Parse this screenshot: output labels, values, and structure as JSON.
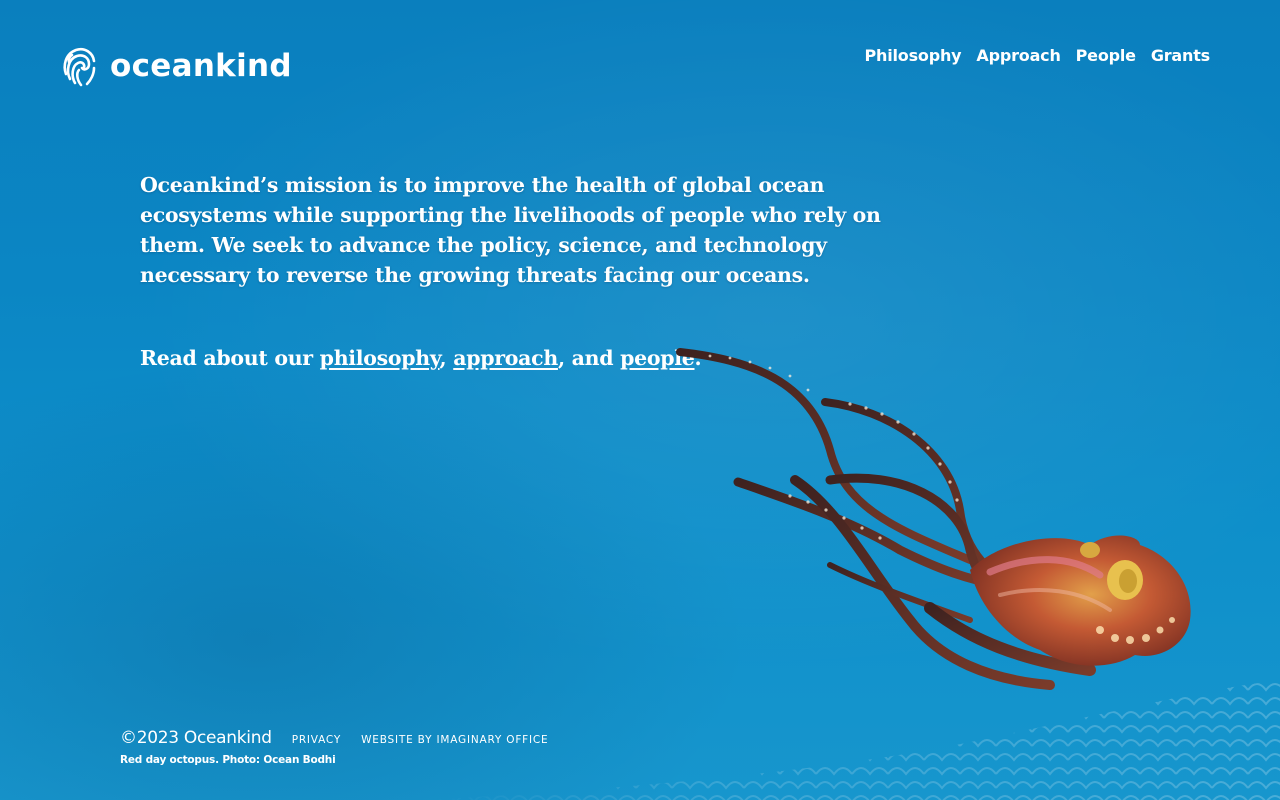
{
  "brand": {
    "name": "oceankind",
    "logo_icon": "fingerprint-wave-icon"
  },
  "nav": {
    "items": [
      {
        "label": "Philosophy"
      },
      {
        "label": "Approach"
      },
      {
        "label": "People"
      },
      {
        "label": "Grants"
      }
    ]
  },
  "main": {
    "mission": "Oceankind’s mission is to improve the health of global ocean ecosystems while supporting the livelihoods of people who rely on them. We seek to advance the policy, science, and technology necessary to reverse the growing threats facing our oceans.",
    "read_prefix": "Read about our ",
    "link_philosophy": "philosophy",
    "sep1": ", ",
    "link_approach": "approach",
    "sep2": ", and ",
    "link_people": "people",
    "read_suffix": "."
  },
  "footer": {
    "copyright": "©2023 Oceankind",
    "privacy": "PRIVACY",
    "credit": "WEBSITE BY IMAGINARY OFFICE",
    "caption": "Red day octopus. Photo: Ocean Bodhi"
  },
  "colors": {
    "background": "#0b86c4",
    "text": "#ffffff",
    "octopus_body": "#b3452e",
    "octopus_tentacle": "#5a2a24"
  }
}
